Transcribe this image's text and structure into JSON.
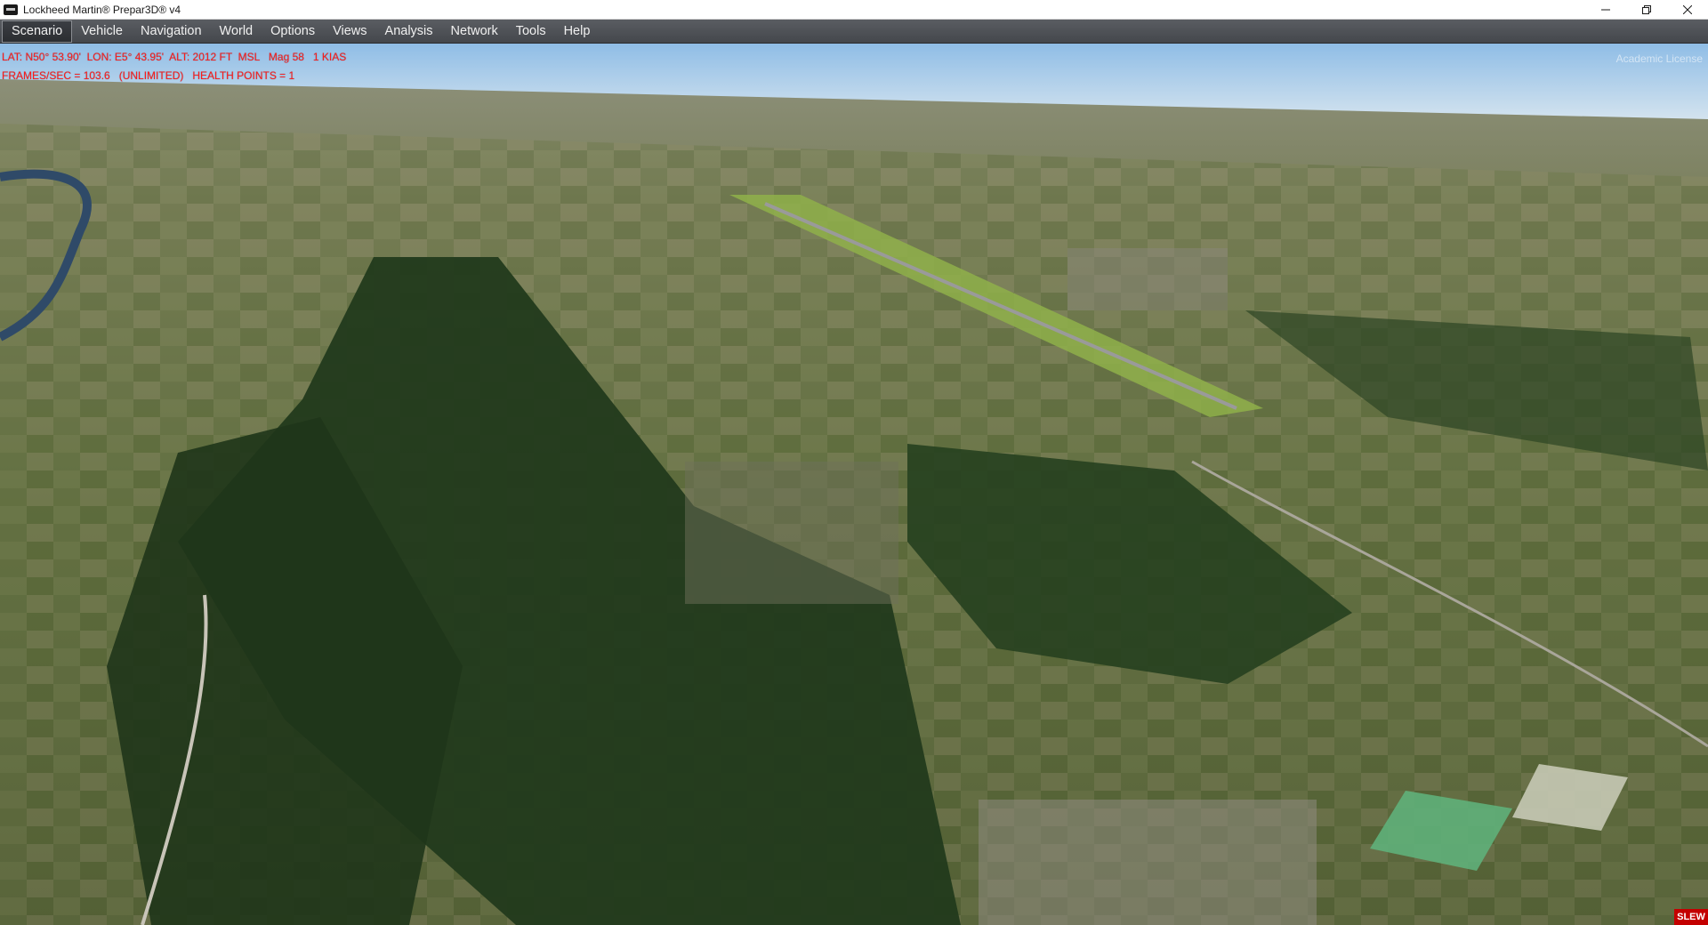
{
  "window": {
    "title": "Lockheed Martin® Prepar3D® v4",
    "controls": [
      "minimize-icon",
      "restore-icon",
      "close-icon"
    ]
  },
  "menu": {
    "items": [
      {
        "label": "Scenario",
        "active": true
      },
      {
        "label": "Vehicle"
      },
      {
        "label": "Navigation"
      },
      {
        "label": "World"
      },
      {
        "label": "Options"
      },
      {
        "label": "Views"
      },
      {
        "label": "Analysis"
      },
      {
        "label": "Network"
      },
      {
        "label": "Tools"
      },
      {
        "label": "Help"
      }
    ]
  },
  "hud": {
    "line1": "LAT: N50° 53.90'  LON: E5° 43.95'  ALT: 2012 FT  MSL   Mag 58   1 KIAS",
    "line2": "FRAMES/SEC = 103.6   (UNLIMITED)   HEALTH POINTS = 1",
    "color": "#ff1a1a"
  },
  "license": "Academic License",
  "slew": "SLEW",
  "colors": {
    "menubar": "#4a4d52",
    "sky_top": "#9cc3e6",
    "forest": "#223a1c",
    "fields": "#6f7a4f"
  }
}
